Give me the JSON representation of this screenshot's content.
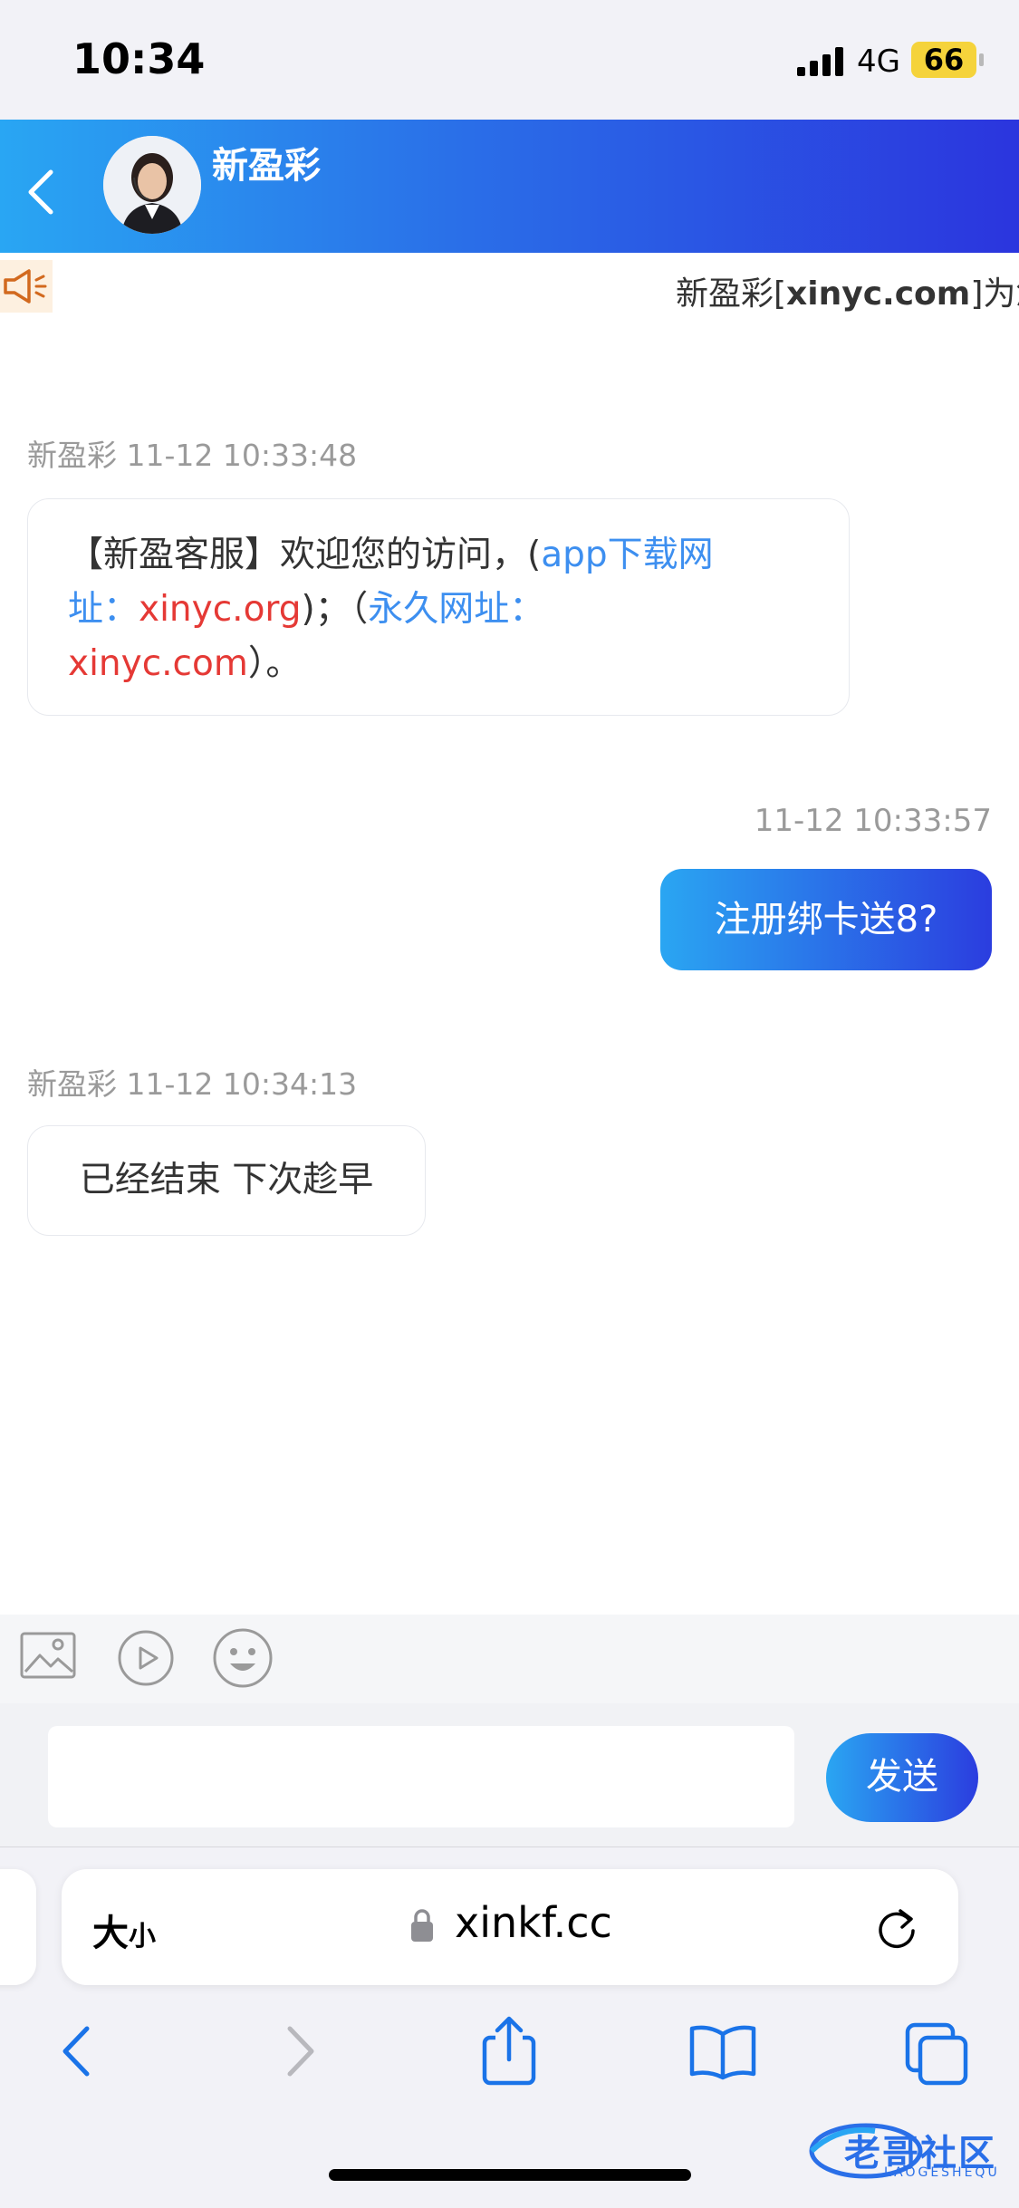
{
  "status": {
    "time": "10:34",
    "network": "4G",
    "battery": "66"
  },
  "header": {
    "title": "新盈彩"
  },
  "notice": {
    "text_prefix": "新盈彩[",
    "text_bold": "xinyc.com",
    "text_suffix": "]为您"
  },
  "messages": [
    {
      "meta": "新盈彩 11-12 10:33:48",
      "p1": "【新盈客服】欢迎您的访问，(",
      "link1": "app下载网址：",
      "red1": "xinyc.org",
      "p2": ")；（",
      "link2": "永久网址：",
      "red2": "xinyc.com",
      "p3": "）。"
    },
    {
      "meta": "11-12 10:33:57",
      "text": "注册绑卡送8?"
    },
    {
      "meta": "新盈彩 11-12 10:34:13",
      "text": "已经结束 下次趁早"
    }
  ],
  "toolbar": {
    "icons": [
      "image-icon",
      "video-icon",
      "emoji-icon"
    ]
  },
  "composer": {
    "placeholder": "",
    "send_label": "发送"
  },
  "browser": {
    "aa_big": "大",
    "aa_small": "小",
    "url": "xinkf.cc"
  },
  "watermark": {
    "text": "老哥社区",
    "sub": "LAOGESHEQU"
  },
  "colors": {
    "header_start": "#29a6f3",
    "header_end": "#2b35de",
    "link": "#3d8ff0",
    "url_red": "#e53935"
  }
}
